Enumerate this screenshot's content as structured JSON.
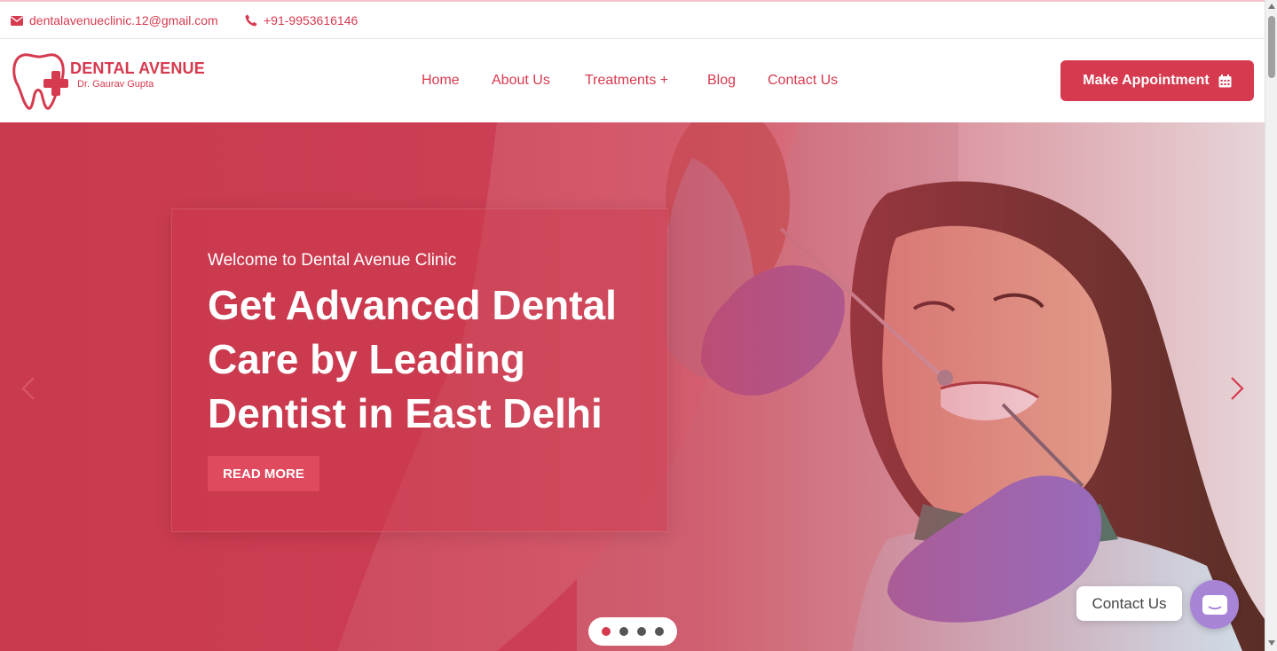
{
  "topbar": {
    "email": "dentalavenueclinic.12@gmail.com",
    "phone": "+91-9953616146",
    "email_icon": "envelope-icon",
    "phone_icon": "phone-icon"
  },
  "header": {
    "logo_name": "DENTAL AVENUE",
    "logo_sub": "Dr. Gaurav Gupta",
    "nav": [
      "Home",
      "About Us",
      "Treatments +",
      "Blog",
      "Contact Us"
    ],
    "appointment_label": "Make Appointment",
    "appointment_icon": "calendar-icon"
  },
  "hero": {
    "welcome": "Welcome to Dental Avenue Clinic",
    "title": "Get Advanced Dental Care by Leading Dentist in East Delhi",
    "read_more": "READ MORE",
    "slides_total": 4,
    "active_slide": 1
  },
  "widget": {
    "contact_label": "Contact Us"
  },
  "colors": {
    "brand": "#d63a4f",
    "widget": "#a784d6"
  }
}
